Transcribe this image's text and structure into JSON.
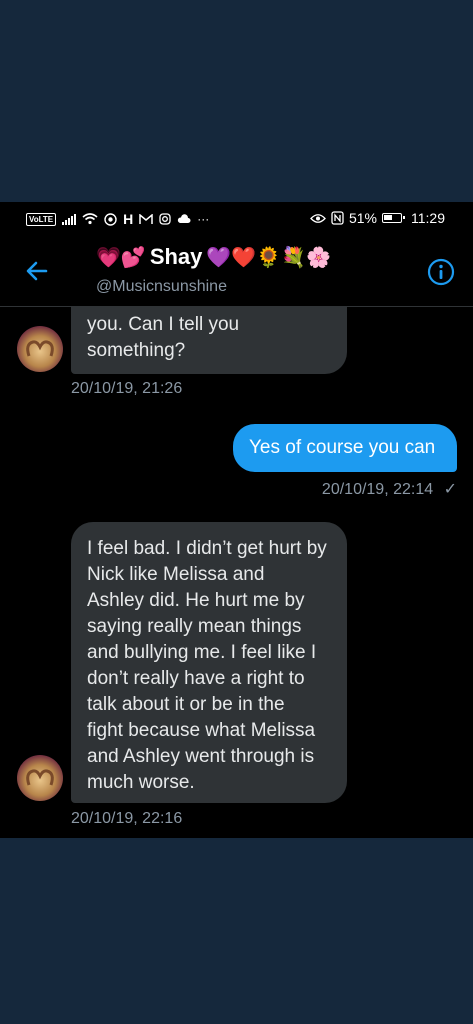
{
  "status_bar": {
    "volte": "VoLTE",
    "h_label": "H",
    "more": "···",
    "battery": "51%",
    "time": "11:29"
  },
  "header": {
    "name": "Shay",
    "handle": "@Musicnsunshine",
    "emoji_before": [
      "💗",
      "💕"
    ],
    "emoji_after": [
      "💜",
      "❤️",
      "🌻",
      "💐",
      "🌸"
    ]
  },
  "messages": [
    {
      "direction": "in",
      "lines": [
        "you. Can I tell you",
        "something?"
      ],
      "timestamp": "20/10/19, 21:26"
    },
    {
      "direction": "out",
      "lines": [
        "Yes of course you can"
      ],
      "timestamp": "20/10/19, 22:14",
      "status": "✓"
    },
    {
      "direction": "in",
      "lines": [
        "I feel bad. I didn’t get hurt by",
        "Nick like Melissa and",
        "Ashley did. He hurt me by",
        "saying really mean things",
        "and bullying me. I feel like I",
        "don’t really have a right to",
        "talk about it or be in the",
        "fight because what Melissa",
        "and Ashley went through is",
        "much worse."
      ],
      "timestamp": "20/10/19, 22:16"
    }
  ],
  "colors": {
    "accent": "#1d9bf0",
    "bubble_in": "#2f3336",
    "frame": "#15283c",
    "muted": "#8b98a5"
  }
}
